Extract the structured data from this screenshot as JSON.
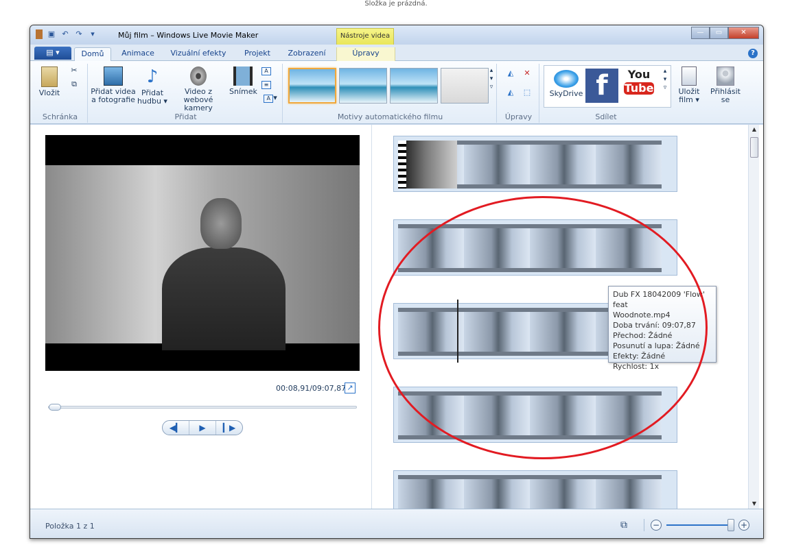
{
  "top_note": "Složka je prázdná.",
  "window": {
    "title": "Můj film – Windows Live Movie Maker",
    "context_tab_header": "Nástroje videa"
  },
  "tabs": {
    "file_button": "▤ ▾",
    "items": [
      "Domů",
      "Animace",
      "Vizuální efekty",
      "Projekt",
      "Zobrazení",
      "Úpravy"
    ]
  },
  "ribbon": {
    "clipboard": {
      "paste": "Vložit",
      "group": "Schránka"
    },
    "add": {
      "add_video_line1": "Přidat videa",
      "add_video_line2": "a fotografie",
      "add_music_line1": "Přidat",
      "add_music_line2": "hudbu ▾",
      "webcam_line1": "Video z webové",
      "webcam_line2": "kamery",
      "snapshot": "Snímek",
      "group": "Přidat"
    },
    "themes": {
      "group": "Motivy automatického filmu"
    },
    "edit": {
      "group": "Úpravy"
    },
    "share": {
      "skydrive": "SkyDrive",
      "youtube_line1": "You",
      "youtube_line2": "Tube",
      "save_line1": "Uložit",
      "save_line2": "film ▾",
      "signin_line1": "Přihlásit",
      "signin_line2": "se",
      "group": "Sdílet"
    }
  },
  "preview": {
    "timecode": "00:08,91/09:07,87"
  },
  "tooltip": {
    "line1": "Dub FX 18042009 'Flow' feat",
    "line2": "Woodnote.mp4",
    "line3": "Doba trvání: 09:07,87",
    "line4": "Přechod: Žádné",
    "line5": "Posunutí a lupa: Žádné",
    "line6": "Efekty: Žádné",
    "line7": "Rychlost: 1x"
  },
  "status": {
    "item_count": "Položka 1 z 1"
  },
  "colors": {
    "accent": "#2b72c8",
    "annotation": "#e21b22",
    "context_tab": "#e9e65a"
  }
}
